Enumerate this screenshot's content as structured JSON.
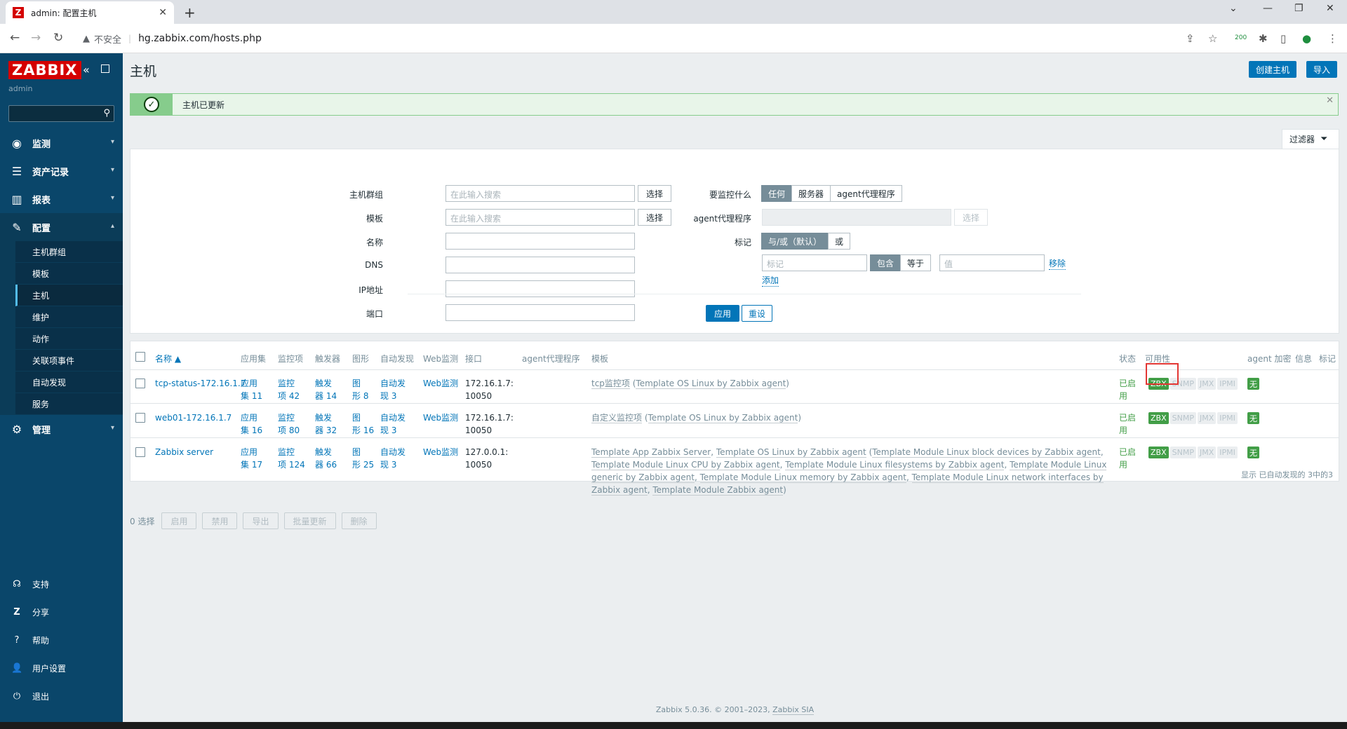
{
  "browser": {
    "tab_title": "admin: 配置主机",
    "favicon_letter": "Z",
    "insecure_label": "不安全",
    "url": "hg.zabbix.com/hosts.php",
    "ext_badge": "200"
  },
  "sidebar": {
    "logo": "ZABBIX",
    "user": "admin",
    "menu": [
      {
        "label": "监测"
      },
      {
        "label": "资产记录"
      },
      {
        "label": "报表"
      },
      {
        "label": "配置"
      },
      {
        "label": "管理"
      }
    ],
    "submenu": [
      {
        "label": "主机群组"
      },
      {
        "label": "模板"
      },
      {
        "label": "主机"
      },
      {
        "label": "维护"
      },
      {
        "label": "动作"
      },
      {
        "label": "关联项事件"
      },
      {
        "label": "自动发现"
      },
      {
        "label": "服务"
      }
    ],
    "bottom": [
      {
        "label": "支持"
      },
      {
        "label": "分享"
      },
      {
        "label": "帮助"
      },
      {
        "label": "用户设置"
      },
      {
        "label": "退出"
      }
    ]
  },
  "header": {
    "title": "主机",
    "create_button": "创建主机",
    "import_button": "导入"
  },
  "message": {
    "text": "主机已更新"
  },
  "filter": {
    "tab_label": "过滤器",
    "host_groups_label": "主机群组",
    "host_groups_placeholder": "在此输入搜索",
    "templates_label": "模板",
    "templates_placeholder": "在此输入搜索",
    "select_button": "选择",
    "name_label": "名称",
    "dns_label": "DNS",
    "ip_label": "IP地址",
    "port_label": "端口",
    "monitored_by_label": "要监控什么",
    "monitored_by_options": [
      "任何",
      "服务器",
      "agent代理程序"
    ],
    "proxy_label": "agent代理程序",
    "tags_label": "标记",
    "tags_mode_options": [
      "与/或（默认）",
      "或"
    ],
    "tag_placeholder": "标记",
    "tag_operator_options": [
      "包含",
      "等于"
    ],
    "value_placeholder": "值",
    "remove_link": "移除",
    "add_link": "添加",
    "apply_button": "应用",
    "reset_button": "重设"
  },
  "table": {
    "headers": {
      "name": "名称 ▲",
      "applications": "应用集",
      "items": "监控项",
      "triggers": "触发器",
      "graphs": "图形",
      "discovery": "自动发现",
      "web": "Web监测",
      "interface": "接口",
      "proxy": "agent代理程序",
      "templates": "模板",
      "status": "状态",
      "availability": "可用性",
      "encryption": "agent 加密",
      "info": "信息",
      "tags": "标记"
    },
    "rows": [
      {
        "name": "tcp-status-172.16.1.7",
        "apps_l1": "应用",
        "apps_l2": "集 11",
        "items_l1": "监控",
        "items_l2": "项 42",
        "triggers_l1": "触发",
        "triggers_l2": "器 14",
        "graphs_l1": "图",
        "graphs_l2": "形 8",
        "disc_l1": "自动发",
        "disc_l2": "现 3",
        "web": "Web监测",
        "if_l1": "172.16.1.7:",
        "if_l2": "10050",
        "tpl_link": "tcp监控项",
        "tpl_paren_link": "Template OS Linux by Zabbix agent",
        "status_l1": "已启",
        "status_l2": "用",
        "zbx": "ZBX",
        "snmp": "SNMP",
        "jmx": "JMX",
        "ipmi": "IPMI",
        "encryption": "无"
      },
      {
        "name": "web01-172.16.1.7",
        "apps_l1": "应用",
        "apps_l2": "集 16",
        "items_l1": "监控",
        "items_l2": "项 80",
        "triggers_l1": "触发",
        "triggers_l2": "器 32",
        "graphs_l1": "图",
        "graphs_l2": "形 16",
        "disc_l1": "自动发",
        "disc_l2": "现 3",
        "web": "Web监测",
        "if_l1": "172.16.1.7:",
        "if_l2": "10050",
        "tpl_link": "自定义监控项",
        "tpl_paren_link": "Template OS Linux by Zabbix agent",
        "status_l1": "已启",
        "status_l2": "用",
        "zbx": "ZBX",
        "snmp": "SNMP",
        "jmx": "JMX",
        "ipmi": "IPMI",
        "encryption": "无"
      },
      {
        "name": "Zabbix server",
        "apps_l1": "应用",
        "apps_l2": "集 17",
        "items_l1": "监控",
        "items_l2": "项 124",
        "triggers_l1": "触发",
        "triggers_l2": "器 66",
        "graphs_l1": "图",
        "graphs_l2": "形 25",
        "disc_l1": "自动发",
        "disc_l2": "现 3",
        "web": "Web监测",
        "if_l1": "127.0.0.1:",
        "if_l2": "10050",
        "tpl_parts": [
          "Template App Zabbix Server",
          "Template OS Linux by Zabbix agent",
          "Template Module Linux block devices by Zabbix agent",
          "Template Module Linux CPU by Zabbix agent",
          "Template Module Linux filesystems by Zabbix agent",
          "Template Module Linux generic by Zabbix agent",
          "Template Module Linux memory by Zabbix agent",
          "Template Module Linux network interfaces by Zabbix agent",
          "Template Module Zabbix agent"
        ],
        "status_l1": "已启",
        "status_l2": "用",
        "zbx": "ZBX",
        "snmp": "SNMP",
        "jmx": "JMX",
        "ipmi": "IPMI",
        "encryption": "无"
      }
    ],
    "footer": "显示 已自动发现的 3中的3"
  },
  "actions": {
    "selected": "0 选择",
    "buttons": [
      "启用",
      "禁用",
      "导出",
      "批量更新",
      "删除"
    ]
  },
  "footer": {
    "text": "Zabbix 5.0.36. © 2001–2023,",
    "link": "Zabbix SIA"
  },
  "colors": {
    "sidebar": "#0a466a",
    "accent": "#0275b8",
    "logo": "#d40000",
    "ok": "#429e47",
    "highlight": "#e33734"
  }
}
